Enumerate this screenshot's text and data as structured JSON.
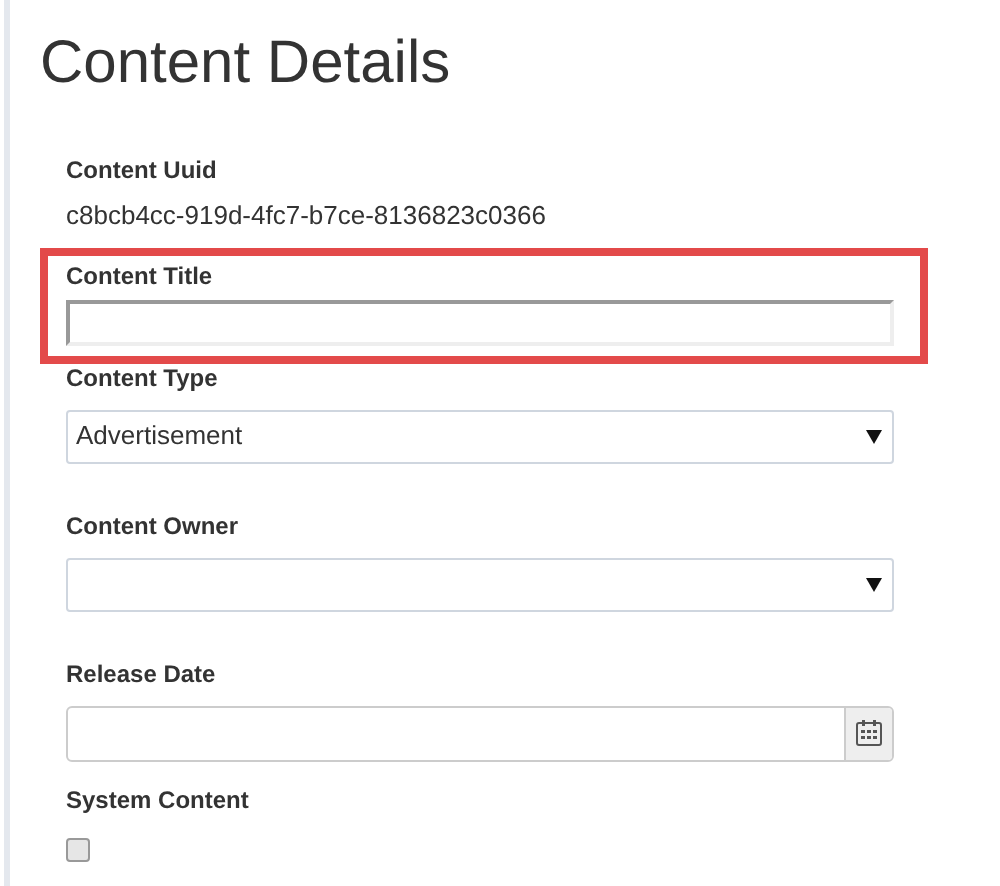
{
  "heading": "Content Details",
  "fields": [
    {
      "kind": "static",
      "label": "Content Uuid",
      "value": "c8bcb4cc-919d-4fc7-b7ce-8136823c0366",
      "highlighted": false
    },
    {
      "kind": "text",
      "label": "Content Title",
      "highlighted": true
    },
    {
      "kind": "select",
      "label": "Content Type",
      "value": "Advertisement",
      "highlighted": false
    },
    {
      "kind": "select",
      "label": "Content Owner",
      "highlighted": false
    },
    {
      "kind": "date",
      "label": "Release Date",
      "highlighted": false
    },
    {
      "kind": "checkbox",
      "label": "System Content",
      "checked": false,
      "highlighted": false
    }
  ]
}
